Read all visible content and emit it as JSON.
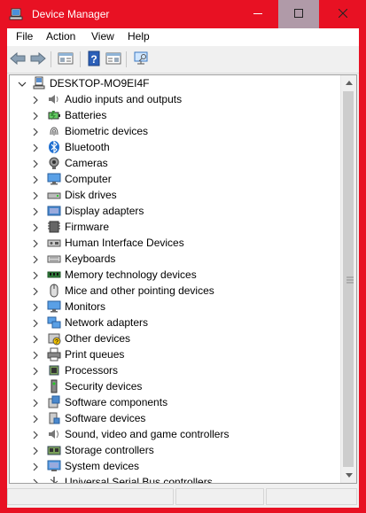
{
  "window": {
    "title": "Device Manager",
    "accent_color": "#e81123",
    "controls": {
      "minimize_icon": "minimize-icon",
      "maximize_icon": "maximize-icon",
      "close_icon": "close-icon"
    }
  },
  "menu": {
    "items": [
      {
        "label": "File"
      },
      {
        "label": "Action"
      },
      {
        "label": "View"
      },
      {
        "label": "Help"
      }
    ]
  },
  "toolbar": {
    "buttons": [
      {
        "icon": "back-arrow-icon"
      },
      {
        "icon": "forward-arrow-icon"
      },
      {
        "icon": "properties-icon"
      },
      {
        "icon": "help-icon"
      },
      {
        "icon": "update-driver-icon"
      },
      {
        "icon": "scan-hardware-icon"
      }
    ]
  },
  "tree": {
    "root": {
      "label": "DESKTOP-MO9EI4F",
      "icon": "computer-root-icon",
      "expanded": true
    },
    "categories": [
      {
        "label": "Audio inputs and outputs",
        "icon": "speaker-icon"
      },
      {
        "label": "Batteries",
        "icon": "battery-icon"
      },
      {
        "label": "Biometric devices",
        "icon": "fingerprint-icon"
      },
      {
        "label": "Bluetooth",
        "icon": "bluetooth-icon"
      },
      {
        "label": "Cameras",
        "icon": "camera-icon"
      },
      {
        "label": "Computer",
        "icon": "monitor-icon"
      },
      {
        "label": "Disk drives",
        "icon": "disk-drive-icon"
      },
      {
        "label": "Display adapters",
        "icon": "display-adapter-icon"
      },
      {
        "label": "Firmware",
        "icon": "firmware-chip-icon"
      },
      {
        "label": "Human Interface Devices",
        "icon": "hid-icon"
      },
      {
        "label": "Keyboards",
        "icon": "keyboard-icon"
      },
      {
        "label": "Memory technology devices",
        "icon": "memory-device-icon"
      },
      {
        "label": "Mice and other pointing devices",
        "icon": "mouse-icon"
      },
      {
        "label": "Monitors",
        "icon": "monitor-icon"
      },
      {
        "label": "Network adapters",
        "icon": "network-adapter-icon"
      },
      {
        "label": "Other devices",
        "icon": "unknown-device-icon"
      },
      {
        "label": "Print queues",
        "icon": "printer-icon"
      },
      {
        "label": "Processors",
        "icon": "processor-icon"
      },
      {
        "label": "Security devices",
        "icon": "security-key-icon"
      },
      {
        "label": "Software components",
        "icon": "software-component-icon"
      },
      {
        "label": "Software devices",
        "icon": "software-device-icon"
      },
      {
        "label": "Sound, video and game controllers",
        "icon": "sound-icon"
      },
      {
        "label": "Storage controllers",
        "icon": "storage-controller-icon"
      },
      {
        "label": "System devices",
        "icon": "system-devices-icon"
      },
      {
        "label": "Universal Serial Bus controllers",
        "icon": "usb-icon"
      }
    ]
  },
  "status": {
    "text": ""
  }
}
